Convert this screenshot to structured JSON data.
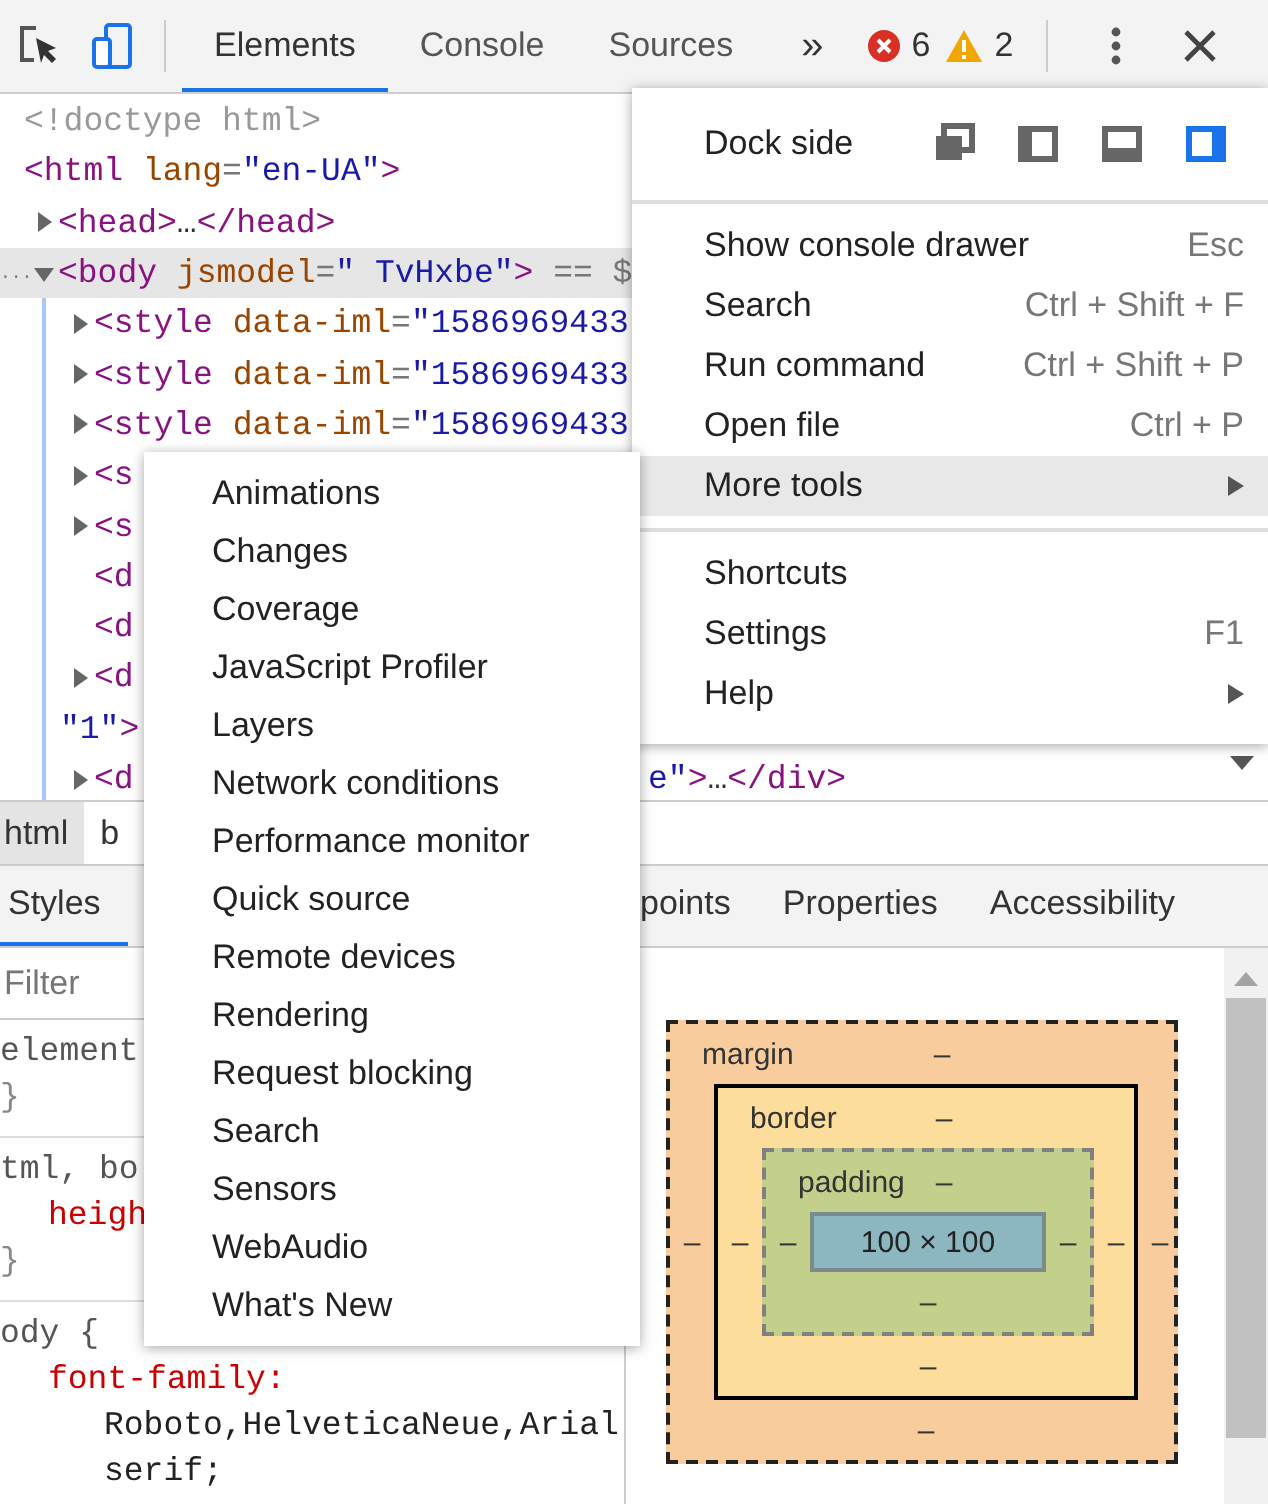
{
  "toolbar": {
    "tabs": [
      {
        "label": "Elements",
        "selected": true
      },
      {
        "label": "Console",
        "selected": false
      },
      {
        "label": "Sources",
        "selected": false
      }
    ],
    "overflow": "»",
    "errors": "6",
    "warnings": "2"
  },
  "dom_tree": {
    "nodes": [
      {
        "segments": [
          {
            "kind": "doctype",
            "text": "<!doctype html>"
          }
        ]
      },
      {
        "segments": [
          {
            "kind": "tag",
            "text": "<html"
          },
          {
            "kind": "attr",
            "text": " lang"
          },
          {
            "kind": "punct",
            "text": "="
          },
          {
            "kind": "value",
            "text": "\"en-UA\""
          },
          {
            "kind": "tag",
            "text": ">"
          }
        ],
        "children": [
          {
            "expanded": false,
            "segments": [
              {
                "kind": "tag",
                "text": "<head>"
              },
              {
                "kind": "text",
                "text": "…"
              },
              {
                "kind": "tag",
                "text": "</head>"
              }
            ]
          },
          {
            "expanded": true,
            "selected": true,
            "marker": "...",
            "segments": [
              {
                "kind": "tag",
                "text": "<body"
              },
              {
                "kind": "attr",
                "text": " jsmodel"
              },
              {
                "kind": "punct",
                "text": "="
              },
              {
                "kind": "value",
                "text": "\" TvHxbe\""
              },
              {
                "kind": "tag",
                "text": ">"
              },
              {
                "kind": "punct",
                "text": " == $"
              }
            ],
            "children": [
              {
                "expanded": false,
                "segments": [
                  {
                    "kind": "tag",
                    "text": "<style"
                  },
                  {
                    "kind": "attr",
                    "text": " data-iml"
                  },
                  {
                    "kind": "punct",
                    "text": "="
                  },
                  {
                    "kind": "value",
                    "text": "\"1586969433"
                  }
                ]
              },
              {
                "expanded": false,
                "segments": [
                  {
                    "kind": "tag",
                    "text": "<style"
                  },
                  {
                    "kind": "attr",
                    "text": " data-iml"
                  },
                  {
                    "kind": "punct",
                    "text": "="
                  },
                  {
                    "kind": "value",
                    "text": "\"1586969433"
                  }
                ]
              },
              {
                "expanded": false,
                "segments": [
                  {
                    "kind": "tag",
                    "text": "<style"
                  },
                  {
                    "kind": "attr",
                    "text": " data-iml"
                  },
                  {
                    "kind": "punct",
                    "text": "="
                  },
                  {
                    "kind": "value",
                    "text": "\"1586969433"
                  }
                ]
              },
              {
                "expanded": false,
                "segments": [
                  {
                    "kind": "tag",
                    "text": "<s"
                  }
                ]
              },
              {
                "expanded": false,
                "segments": [
                  {
                    "kind": "tag",
                    "text": "<s"
                  }
                ]
              },
              {
                "segments": [
                  {
                    "kind": "tag",
                    "text": "<d"
                  }
                ]
              },
              {
                "segments": [
                  {
                    "kind": "tag",
                    "text": "<d"
                  }
                ]
              },
              {
                "expanded": false,
                "segments": [
                  {
                    "kind": "tag",
                    "text": "<d"
                  }
                ],
                "wrap": [
                  {
                    "kind": "value",
                    "text": "\"1\""
                  },
                  {
                    "kind": "tag",
                    "text": ">"
                  }
                ]
              },
              {
                "expanded": false,
                "segments": [
                  {
                    "kind": "tag",
                    "text": "<d"
                  }
                ],
                "tail": [
                  {
                    "kind": "value",
                    "text": "e\""
                  },
                  {
                    "kind": "tag",
                    "text": ">"
                  },
                  {
                    "kind": "text",
                    "text": "…"
                  },
                  {
                    "kind": "tag",
                    "text": "</div>"
                  }
                ]
              }
            ]
          }
        ]
      }
    ]
  },
  "breadcrumbs": [
    {
      "label": "html",
      "selected": true
    },
    {
      "label": "b",
      "selected": false
    }
  ],
  "panel_tabs": [
    {
      "label": "Styles",
      "selected": true
    },
    {
      "label": "points",
      "selected": false
    },
    {
      "label": "Properties",
      "selected": false
    },
    {
      "label": "Accessibility",
      "selected": false
    }
  ],
  "styles": {
    "filter": {
      "placeholder": "Filter"
    },
    "rules": [
      {
        "lines": [
          {
            "kind": "selector",
            "text": "element"
          },
          {
            "kind": "brace",
            "text": "}"
          }
        ]
      },
      {
        "lines": [
          {
            "kind": "selector",
            "text": "tml, bo"
          },
          {
            "kind": "property",
            "text": "heigh"
          },
          {
            "kind": "brace",
            "text": "}"
          }
        ]
      },
      {
        "lines": [
          {
            "kind": "selector",
            "text": "ody {"
          },
          {
            "kind": "property",
            "text": "font-family:"
          },
          {
            "kind": "value",
            "text": "Roboto,HelveticaNeue,Arial"
          },
          {
            "kind": "value",
            "text": "serif;"
          }
        ]
      }
    ]
  },
  "box_model": {
    "margin": {
      "label": "margin",
      "top": "–",
      "right": "–",
      "bottom": "–",
      "left": "–"
    },
    "border": {
      "label": "border",
      "top": "–",
      "right": "–",
      "bottom": "–",
      "left": "–"
    },
    "padding": {
      "label": "padding",
      "top": "–",
      "right": "–",
      "bottom": "–",
      "left": "–"
    },
    "content": "100 × 100"
  },
  "main_menu": {
    "dock": {
      "label": "Dock side",
      "options": [
        {
          "kind": "undock",
          "selected": false
        },
        {
          "kind": "left",
          "selected": false
        },
        {
          "kind": "bottom",
          "selected": false
        },
        {
          "kind": "right",
          "selected": true
        }
      ]
    },
    "sections": [
      [
        {
          "label": "Show console drawer",
          "shortcut": "Esc",
          "highlighted": false,
          "submenu": false
        },
        {
          "label": "Search",
          "shortcut": "Ctrl + Shift + F",
          "highlighted": false,
          "submenu": false
        },
        {
          "label": "Run command",
          "shortcut": "Ctrl + Shift + P",
          "highlighted": false,
          "submenu": false
        },
        {
          "label": "Open file",
          "shortcut": "Ctrl + P",
          "highlighted": false,
          "submenu": false
        },
        {
          "label": "More tools",
          "highlighted": true,
          "submenu": true
        }
      ],
      [
        {
          "label": "Shortcuts",
          "highlighted": false,
          "submenu": false
        },
        {
          "label": "Settings",
          "shortcut": "F1",
          "highlighted": false,
          "submenu": false
        },
        {
          "label": "Help",
          "highlighted": false,
          "submenu": true
        }
      ]
    ]
  },
  "more_tools_menu": {
    "items": [
      "Animations",
      "Changes",
      "Coverage",
      "JavaScript Profiler",
      "Layers",
      "Network conditions",
      "Performance monitor",
      "Quick source",
      "Remote devices",
      "Rendering",
      "Request blocking",
      "Search",
      "Sensors",
      "WebAudio",
      "What's New"
    ]
  }
}
